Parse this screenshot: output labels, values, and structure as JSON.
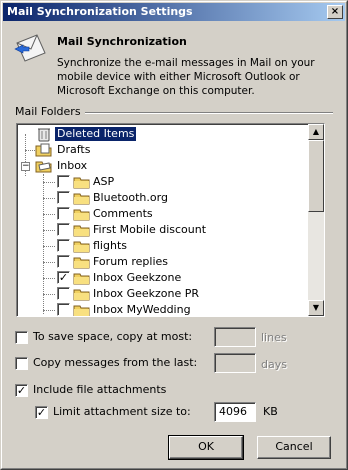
{
  "window": {
    "title": "Mail Synchronization Settings",
    "close_glyph": "×"
  },
  "header": {
    "icon": "mail-envelope-icon",
    "title": "Mail Synchronization",
    "description": "Synchronize the e-mail messages in Mail on your mobile device with either Microsoft Outlook or Microsoft Exchange on this computer."
  },
  "folders_group": {
    "label": "Mail Folders"
  },
  "tree": {
    "top_level": [
      {
        "label": "Deleted Items",
        "selected": true,
        "icon": "trash-folder-icon"
      },
      {
        "label": "Drafts",
        "selected": false,
        "icon": "drafts-folder-icon"
      },
      {
        "label": "Inbox",
        "selected": false,
        "icon": "inbox-folder-icon",
        "expanded": true
      }
    ],
    "inbox_children": [
      {
        "label": "ASP",
        "checked": false
      },
      {
        "label": "Bluetooth.org",
        "checked": false
      },
      {
        "label": "Comments",
        "checked": false
      },
      {
        "label": "First Mobile discount",
        "checked": false
      },
      {
        "label": "flights",
        "checked": false
      },
      {
        "label": "Forum replies",
        "checked": false
      },
      {
        "label": "Inbox Geekzone",
        "checked": true
      },
      {
        "label": "Inbox Geekzone PR",
        "checked": false
      },
      {
        "label": "Inbox MyWedding",
        "checked": false
      }
    ],
    "expander_minus": "−",
    "check_glyph": "✓"
  },
  "options": {
    "save_space": {
      "label": "To save space, copy at most:",
      "checked": false,
      "value": "",
      "unit": "lines"
    },
    "copy_from_last": {
      "label": "Copy messages from the last:",
      "checked": false,
      "value": "",
      "unit": "days"
    },
    "include_attachments": {
      "label": "Include file attachments",
      "checked": true
    },
    "limit_attachment": {
      "label": "Limit attachment size to:",
      "checked": true,
      "value": "4096",
      "unit": "KB"
    }
  },
  "buttons": {
    "ok": "OK",
    "cancel": "Cancel"
  },
  "scrollbar": {
    "up_glyph": "▲",
    "down_glyph": "▼"
  }
}
